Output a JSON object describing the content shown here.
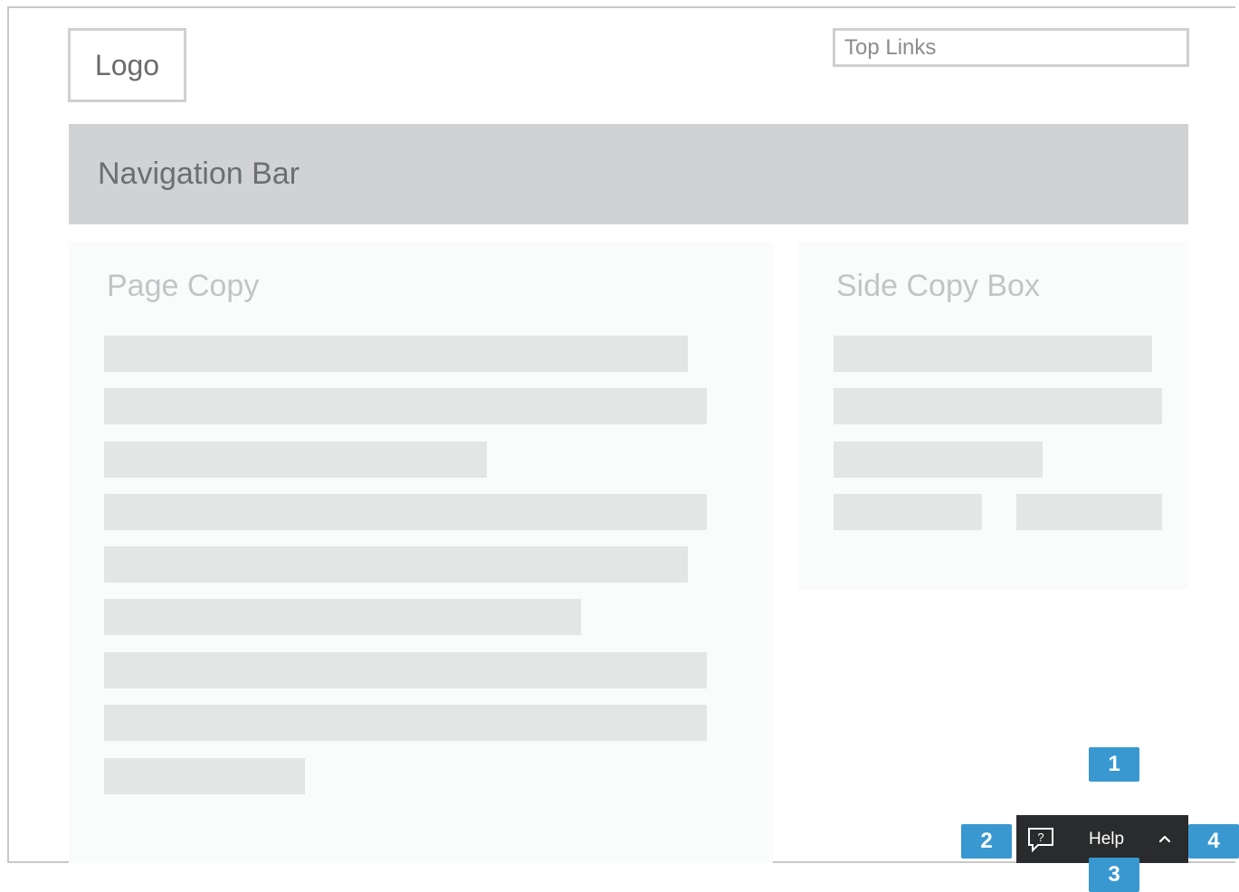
{
  "header": {
    "logo_text": "Logo",
    "top_links_text": "Top Links"
  },
  "navigation": {
    "label": "Navigation Bar"
  },
  "page_copy": {
    "title": "Page Copy"
  },
  "side_copy": {
    "title": "Side Copy Box"
  },
  "help_widget": {
    "label": "Help",
    "icon": "help-bubble-icon",
    "chevron_icon": "chevron-up-icon"
  },
  "callouts": [
    "1",
    "2",
    "3",
    "4"
  ],
  "colors": {
    "nav_background": "#d1d2d4",
    "placeholder_line": "#e4e5e5",
    "help_bar": "#2a2b2c",
    "callout_blue": "#3a98d1"
  }
}
